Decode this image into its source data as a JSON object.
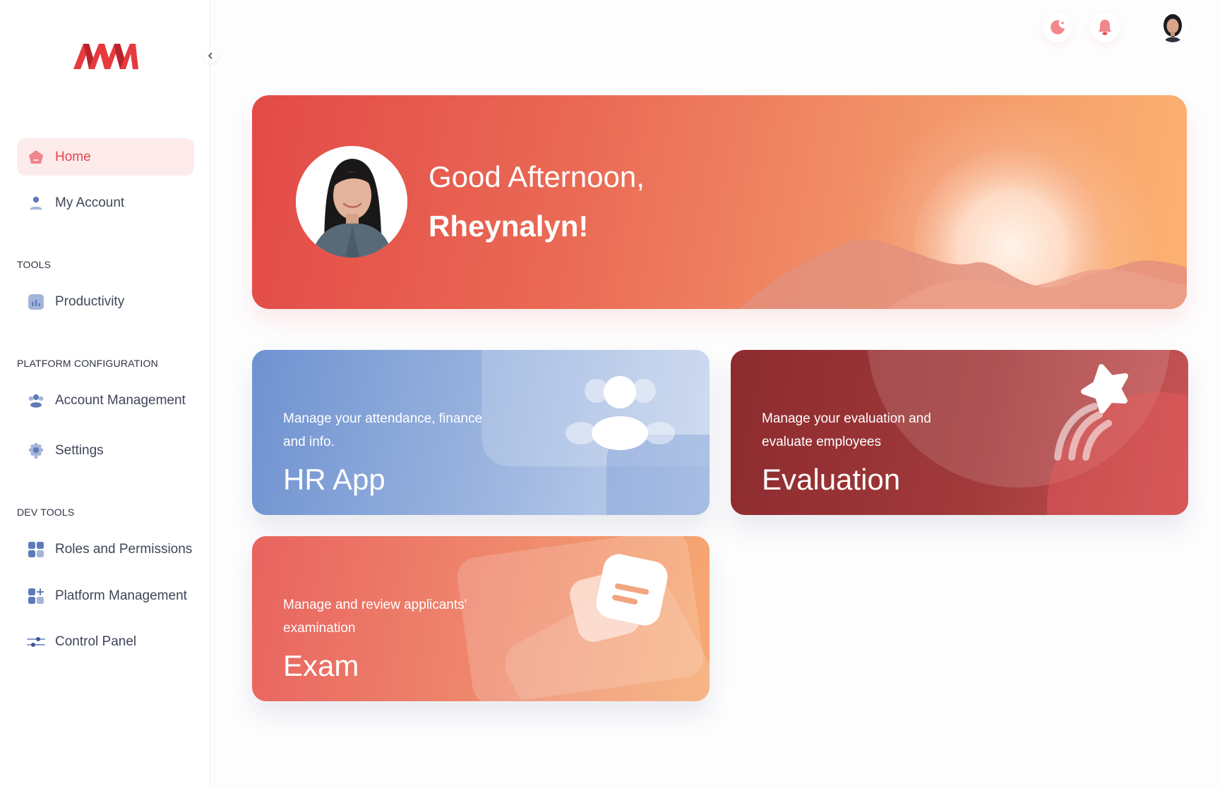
{
  "sidebar": {
    "home": {
      "label": "Home",
      "icon": "home-icon"
    },
    "my_account": {
      "label": "My Account",
      "icon": "user-icon"
    },
    "sections": {
      "tools": "TOOLS",
      "platform_configuration": "PLATFORM CONFIGURATION",
      "dev_tools": "DEV TOOLS"
    },
    "productivity": {
      "label": "Productivity",
      "icon": "chart-icon"
    },
    "account_management": {
      "label": "Account Management",
      "icon": "users-icon"
    },
    "settings": {
      "label": "Settings",
      "icon": "gear-icon"
    },
    "roles_permissions": {
      "label": "Roles and Permissions",
      "icon": "grid-icon"
    },
    "platform_management": {
      "label": "Platform Management",
      "icon": "grid-plus-icon"
    },
    "control_panel": {
      "label": "Control Panel",
      "icon": "sliders-icon"
    }
  },
  "topbar": {
    "icons": [
      "theme-icon",
      "bell-icon",
      "profile-avatar"
    ]
  },
  "hero": {
    "greeting": "Good Afternoon,",
    "name": "Rheynalyn!"
  },
  "cards": {
    "hr": {
      "description": "Manage your attendance, finance and info.",
      "title": "HR App"
    },
    "evaluation": {
      "description": "Manage your evaluation and evaluate employees",
      "title": "Evaluation"
    },
    "exam": {
      "description": "Manage and review applicants' examination",
      "title": "Exam"
    }
  },
  "colors": {
    "accent": "#e5474b",
    "active_bg": "#fdebeb",
    "nav_icon": "#6f84b3",
    "hr_card": "#7c9bd4",
    "evaluation_card": "#9c3536",
    "exam_card": "#ee7f67"
  }
}
